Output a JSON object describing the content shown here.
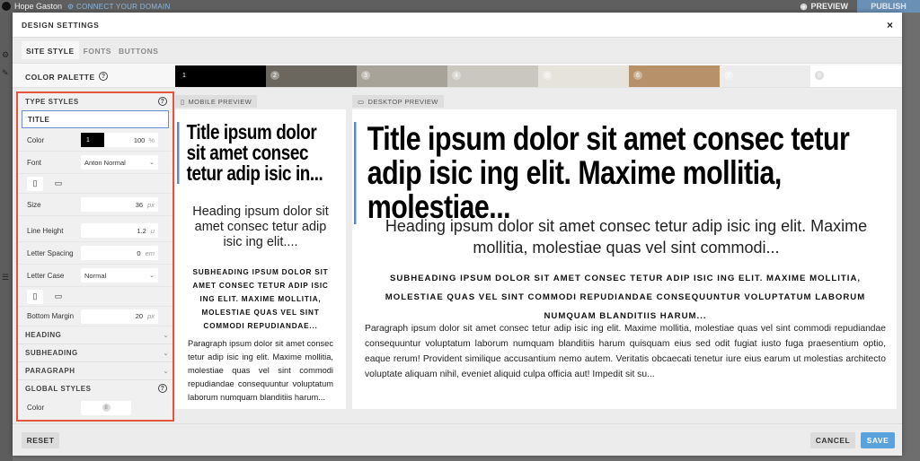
{
  "topbar": {
    "site_name": "Hope Gaston",
    "connect_label": "⚙ CONNECT YOUR DOMAIN",
    "preview_label": "PREVIEW",
    "publish_label": "PUBLISH"
  },
  "modal": {
    "title": "DESIGN SETTINGS",
    "close_label": "×",
    "tabs": [
      {
        "label": "SITE STYLE",
        "active": true
      },
      {
        "label": "FONTS",
        "active": false
      },
      {
        "label": "BUTTONS",
        "active": false
      }
    ]
  },
  "palette": {
    "label": "COLOR PALETTE",
    "help": "?",
    "swatches": [
      {
        "num": "1",
        "color": "#000000"
      },
      {
        "num": "2",
        "color": "#6b665e"
      },
      {
        "num": "3",
        "color": "#a8a399"
      },
      {
        "num": "4",
        "color": "#cac7c0"
      },
      {
        "num": "5",
        "color": "#e6e3dc"
      },
      {
        "num": "6",
        "color": "#b6916a"
      },
      {
        "num": "7",
        "color": "#ececec"
      },
      {
        "num": "8",
        "color": "#ffffff"
      }
    ]
  },
  "type_styles": {
    "heading": "TYPE STYLES",
    "help": "?",
    "selected": "TITLE",
    "color_label": "Color",
    "color_num": "1",
    "color_opacity": "100",
    "color_unit": "%",
    "font_label": "Font",
    "font_value": "Anton Normal",
    "size_label": "Size",
    "size_value": "36",
    "size_unit": "px",
    "line_height_label": "Line Height",
    "line_height_value": "1.2",
    "line_height_unit": "u",
    "letter_spacing_label": "Letter Spacing",
    "letter_spacing_value": "0",
    "letter_spacing_unit": "em",
    "letter_case_label": "Letter Case",
    "letter_case_value": "Normal",
    "bottom_margin_label": "Bottom Margin",
    "bottom_margin_value": "20",
    "bottom_margin_unit": "px",
    "collapsed": [
      "HEADING",
      "SUBHEADING",
      "PARAGRAPH"
    ]
  },
  "global_styles": {
    "heading": "GLOBAL STYLES",
    "help": "?",
    "color_label": "Color",
    "color_num": "8"
  },
  "mobile_preview": {
    "tab_label": "MOBILE PREVIEW",
    "title": "Title ipsum dolor sit amet consec tetur adip isic in...",
    "heading": "Heading ipsum dolor sit amet consec tetur adip isic ing elit....",
    "subheading": "SUBHEADING IPSUM DOLOR SIT AMET CONSEC TETUR ADIP ISIC ING ELIT. MAXIME MOLLITIA, MOLESTIAE QUAS VEL SINT COMMODI REPUDIANDAE...",
    "paragraph": "Paragraph ipsum dolor sit amet consec tetur adip isic ing elit. Maxime mollitia, molestiae quas vel sint commodi repudiandae consequuntur voluptatum laborum numquam blanditiis harum..."
  },
  "desktop_preview": {
    "tab_label": "DESKTOP PREVIEW",
    "title": "Title ipsum dolor sit amet consec tetur adip isic ing elit. Maxime mollitia, molestiae...",
    "heading": "Heading ipsum dolor sit amet consec tetur adip isic ing elit. Maxime mollitia, molestiae quas vel sint commodi...",
    "subheading": "SUBHEADING IPSUM DOLOR SIT AMET CONSEC TETUR ADIP ISIC ING ELIT. MAXIME MOLLITIA, MOLESTIAE QUAS VEL SINT COMMODI REPUDIANDAE CONSEQUUNTUR VOLUPTATUM LABORUM NUMQUAM BLANDITIIS HARUM...",
    "paragraph": "Paragraph ipsum dolor sit amet consec tetur adip isic ing elit. Maxime mollitia, molestiae quas vel sint commodi repudiandae consequuntur voluptatum laborum numquam blanditiis harum quisquam eius sed odit fugiat iusto fuga praesentium optio, eaque rerum! Provident similique accusantium nemo autem. Veritatis obcaecati tenetur iure eius earum ut molestias architecto voluptate aliquam nihil, eveniet aliquid culpa officia aut! Impedit sit su..."
  },
  "footer": {
    "reset_label": "RESET",
    "cancel_label": "CANCEL",
    "save_label": "SAVE"
  },
  "colors": {
    "accent": "#5aa2dc",
    "highlight": "#e4553b",
    "title_bar": "#5a8ac0"
  }
}
